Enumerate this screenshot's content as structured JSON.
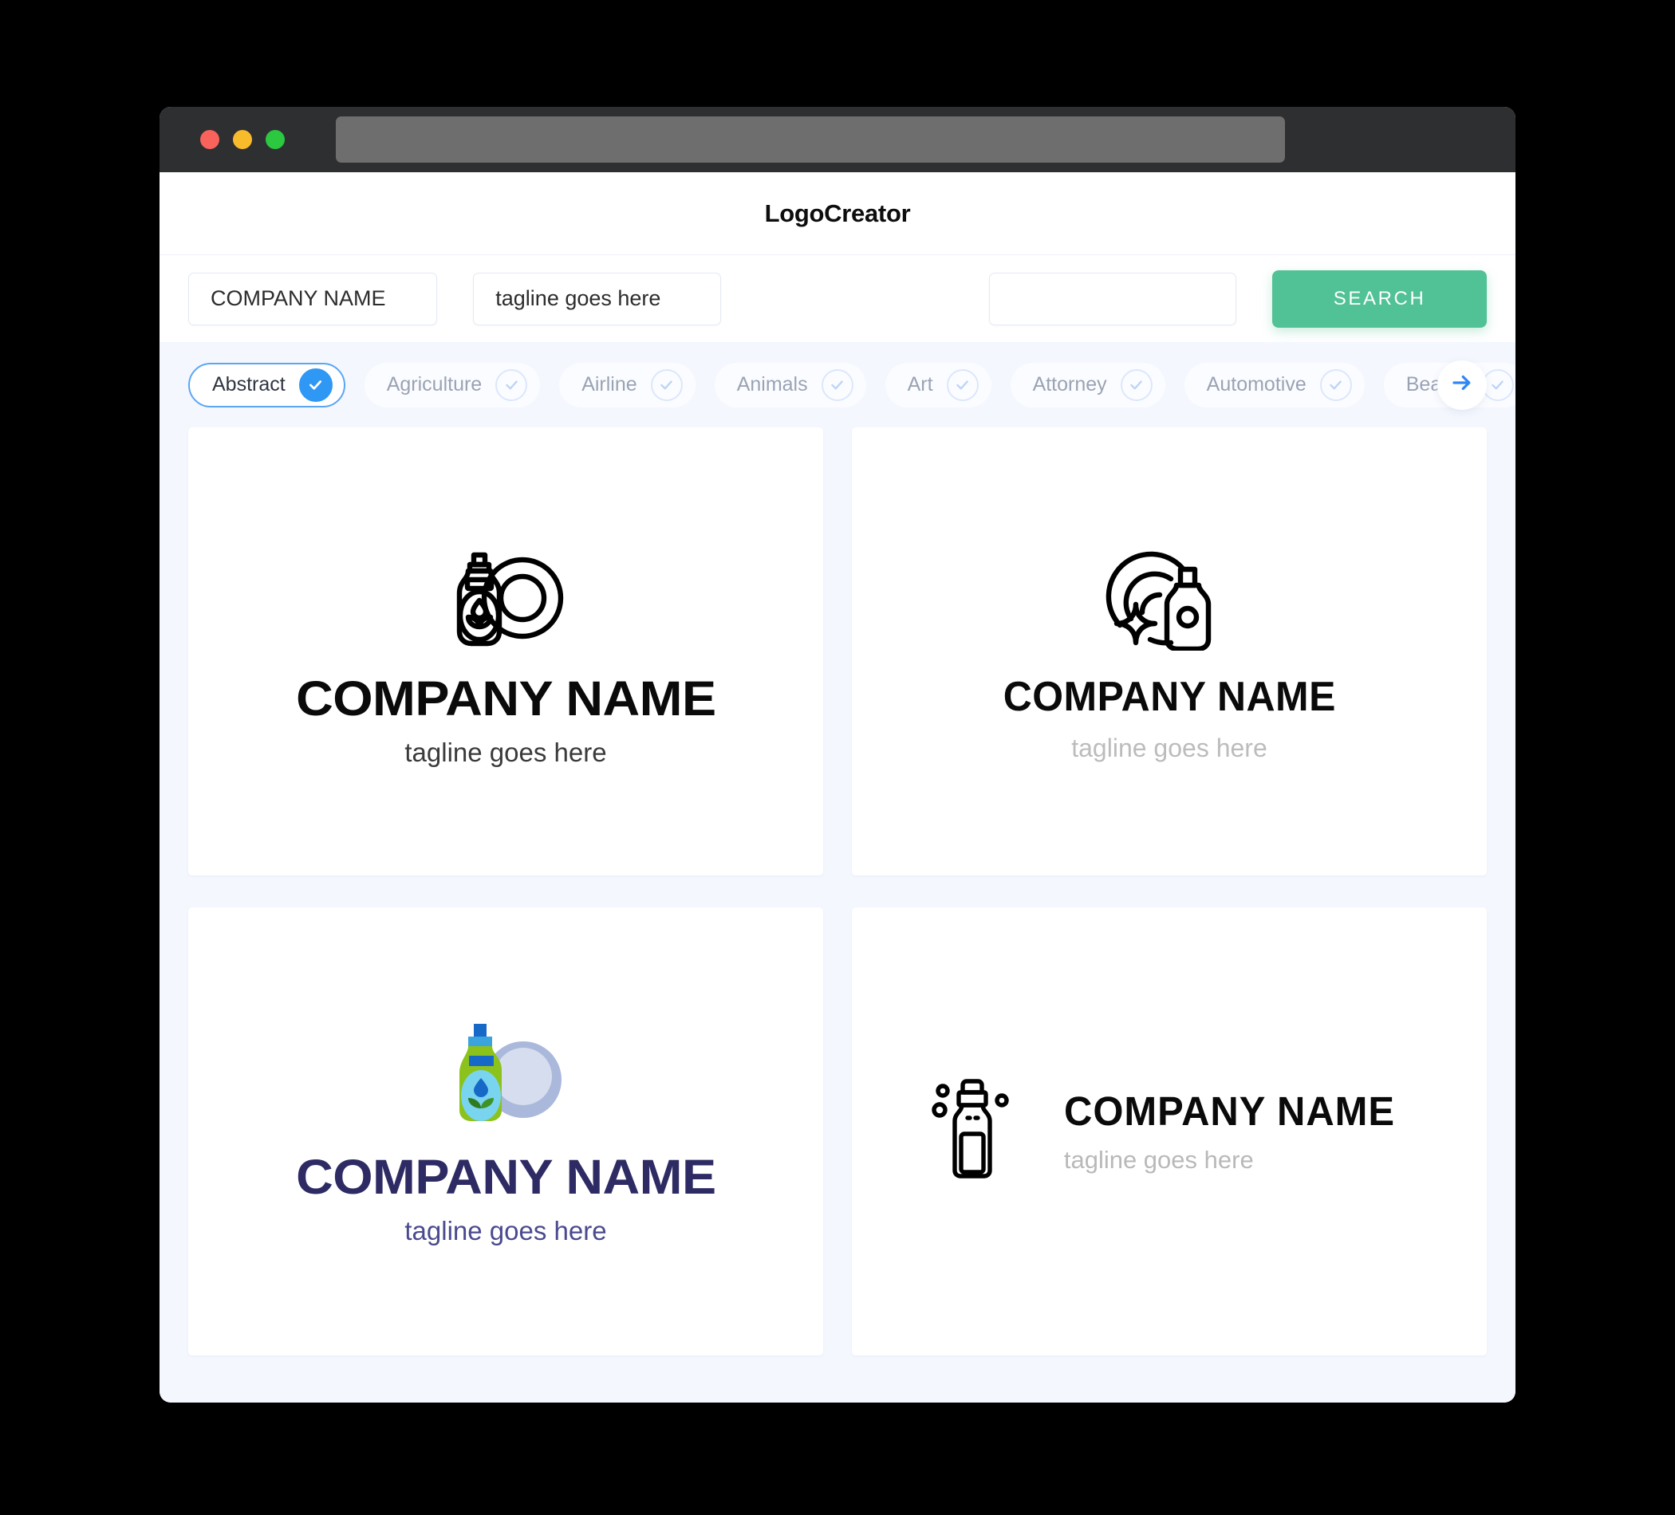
{
  "window": {
    "traffic_lights": [
      "close",
      "minimize",
      "maximize"
    ],
    "url_value": ""
  },
  "header": {
    "app_title": "LogoCreator"
  },
  "search": {
    "company_value": "COMPANY NAME",
    "company_placeholder": "COMPANY NAME",
    "tagline_value": "tagline goes here",
    "tagline_placeholder": "tagline goes here",
    "keyword_value": "",
    "keyword_placeholder": "",
    "search_button": "SEARCH"
  },
  "filters": {
    "next_icon": "arrow-right-icon",
    "chips": [
      {
        "label": "Abstract",
        "selected": true,
        "icon": "check-icon"
      },
      {
        "label": "Agriculture",
        "selected": false,
        "icon": "check-icon"
      },
      {
        "label": "Airline",
        "selected": false,
        "icon": "check-icon"
      },
      {
        "label": "Animals",
        "selected": false,
        "icon": "check-icon"
      },
      {
        "label": "Art",
        "selected": false,
        "icon": "check-icon"
      },
      {
        "label": "Attorney",
        "selected": false,
        "icon": "check-icon"
      },
      {
        "label": "Automotive",
        "selected": false,
        "icon": "check-icon"
      },
      {
        "label": "Beauty",
        "selected": false,
        "icon": "check-icon"
      }
    ]
  },
  "results": {
    "cards": [
      {
        "id": "logo-card-1",
        "icon": "detergent-bottle-and-plate-outline-icon",
        "name": "COMPANY NAME",
        "tagline": "tagline goes here",
        "name_color": "#0a0a0a",
        "tagline_color": "#3a3a3a",
        "layout": "stacked"
      },
      {
        "id": "logo-card-2",
        "icon": "sparkle-plate-and-bottle-outline-icon",
        "name": "COMPANY NAME",
        "tagline": "tagline goes here",
        "name_color": "#0a0a0a",
        "tagline_color": "#bcbcbc",
        "layout": "stacked"
      },
      {
        "id": "logo-card-3",
        "icon": "detergent-bottle-and-plate-color-icon",
        "name": "COMPANY NAME",
        "tagline": "tagline goes here",
        "name_color": "#2e2b64",
        "tagline_color": "#4a4a8f",
        "layout": "stacked"
      },
      {
        "id": "logo-card-4",
        "icon": "bottle-with-bubbles-outline-icon",
        "name": "COMPANY NAME",
        "tagline": "tagline goes here",
        "name_color": "#0a0a0a",
        "tagline_color": "#b9b9b9",
        "layout": "horizontal"
      }
    ]
  },
  "colors": {
    "accent_green": "#51c196",
    "accent_blue": "#2f97f4",
    "page_bg": "#f4f7fe",
    "titlebar": "#2e2f31",
    "logo_green": "#8cc21c",
    "logo_blue": "#1769c8",
    "logo_lightblue": "#79d4ef",
    "logo_plate": "#aab8db",
    "logo_navy": "#2e2b64"
  }
}
